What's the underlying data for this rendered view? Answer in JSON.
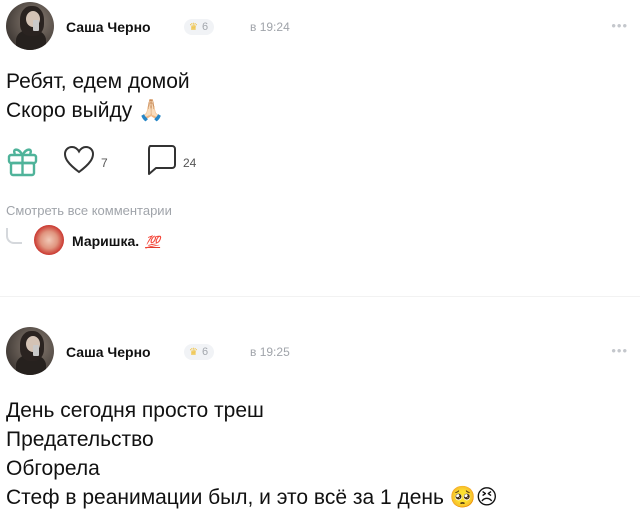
{
  "posts": [
    {
      "author": "Саша Черно",
      "badge_count": "6",
      "time": "в 19:24",
      "lines": [
        "Ребят, едем домой",
        "Скоро выйду 🙏🏻"
      ],
      "likes": "7",
      "comments": "24",
      "view_comments_label": "Смотреть все комментарии",
      "reply_author": "Маришка.",
      "reply_emoji": "💯"
    },
    {
      "author": "Саша Черно",
      "badge_count": "6",
      "time": "в 19:25",
      "lines": [
        "День сегодня просто треш",
        "Предательство",
        "Обгорела",
        "Стеф в реанимации был, и это всё за 1 день 🥺😣"
      ]
    }
  ],
  "icons": {
    "badge": "crown-icon",
    "more": "more-dots-icon",
    "gift": "gift-icon",
    "like": "heart-icon",
    "comment": "comment-icon"
  },
  "colors": {
    "accent": "#4fb39a",
    "muted": "#a0a4aa"
  }
}
